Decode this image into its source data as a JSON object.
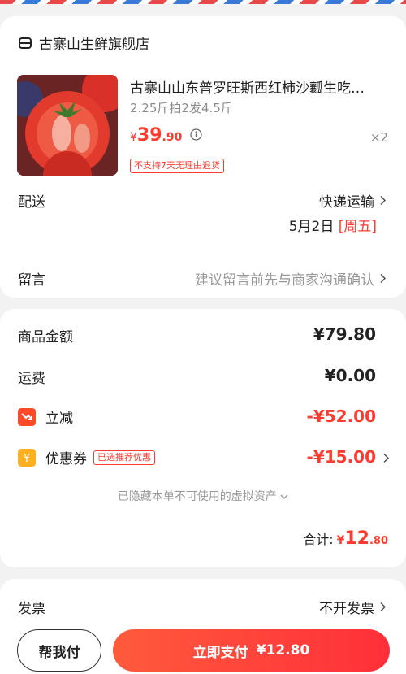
{
  "shop": {
    "name": "古寨山生鲜旗舰店"
  },
  "product": {
    "title": "古寨山山东普罗旺斯西红柿沙瓤生吃…",
    "spec": "2.25斤拍2发4.5斤",
    "price_symbol": "¥",
    "price_int": "39",
    "price_dec": ".90",
    "quantity": "×2",
    "tag": "不支持7天无理由退货"
  },
  "delivery": {
    "label": "配送",
    "method": "快递运输",
    "date": "5月2日",
    "weekday": "[周五]"
  },
  "note": {
    "label": "留言",
    "placeholder": "建议留言前先与商家沟通确认"
  },
  "summary": {
    "goods_label": "商品金额",
    "goods_value": "¥79.80",
    "shipping_label": "运费",
    "shipping_value": "¥0.00",
    "discount_label": "立减",
    "discount_value": "-¥52.00",
    "coupon_label": "优惠券",
    "coupon_tag": "已选推荐优惠",
    "coupon_value": "-¥15.00",
    "hidden_assets": "已隐藏本单不可使用的虚拟资产",
    "total_label": "合计:",
    "total_symbol": "¥",
    "total_int": "12",
    "total_dec": ".80"
  },
  "invoice": {
    "label": "发票",
    "value": "不开发票"
  },
  "footer": {
    "help_pay": "帮我付",
    "pay_now": "立即支付",
    "pay_amount": "¥12.80"
  },
  "colors": {
    "accent": "#ff3b30",
    "background": "#f2f2f2"
  },
  "icons": [
    "shop-icon",
    "info-icon",
    "chevron-right-icon",
    "discount-icon",
    "coupon-icon",
    "chevron-down-icon"
  ]
}
